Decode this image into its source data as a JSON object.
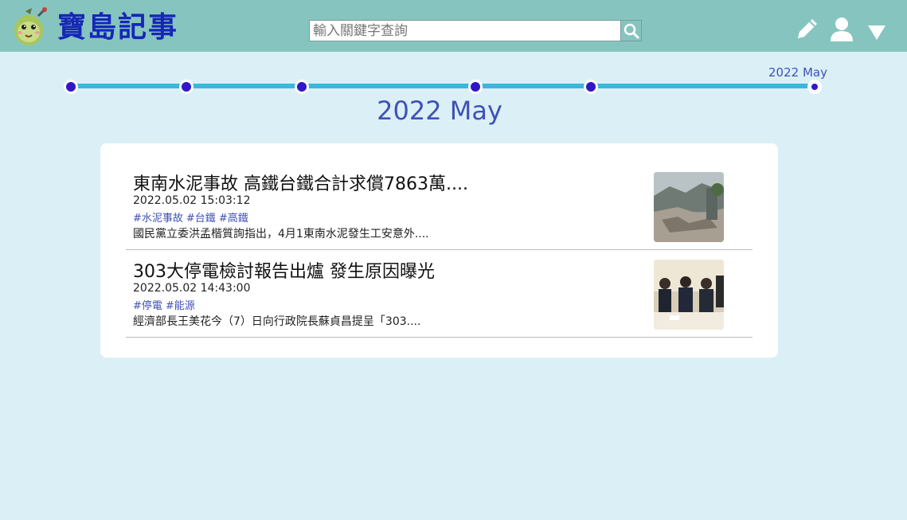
{
  "header": {
    "site_title": "寶島記事",
    "search_placeholder": "輸入關鍵字查詢",
    "colors": {
      "bar": "#86c5bf",
      "title": "#1626b8"
    }
  },
  "timeline": {
    "current_label": "2022 May",
    "dot_count": 6,
    "colors": {
      "line": "#38b8dc",
      "dot": "#3018c8"
    }
  },
  "month_title": "2022 May",
  "articles": [
    {
      "title": "東南水泥事故 高鐵台鐵合計求償7863萬....",
      "date": "2022.05.02 15:03:12",
      "tags": [
        "#水泥事故",
        "#台鐵",
        "#高鐵"
      ],
      "summary": "國民黨立委洪孟楷質詢指出，4月1東南水泥發生工安意外...."
    },
    {
      "title": "303大停電檢討報告出爐 發生原因曝光",
      "date": "2022.05.02 14:43:00",
      "tags": [
        "#停電",
        "#能源"
      ],
      "summary": "經濟部長王美花今（7）日向行政院長蘇貞昌提呈「303...."
    }
  ]
}
